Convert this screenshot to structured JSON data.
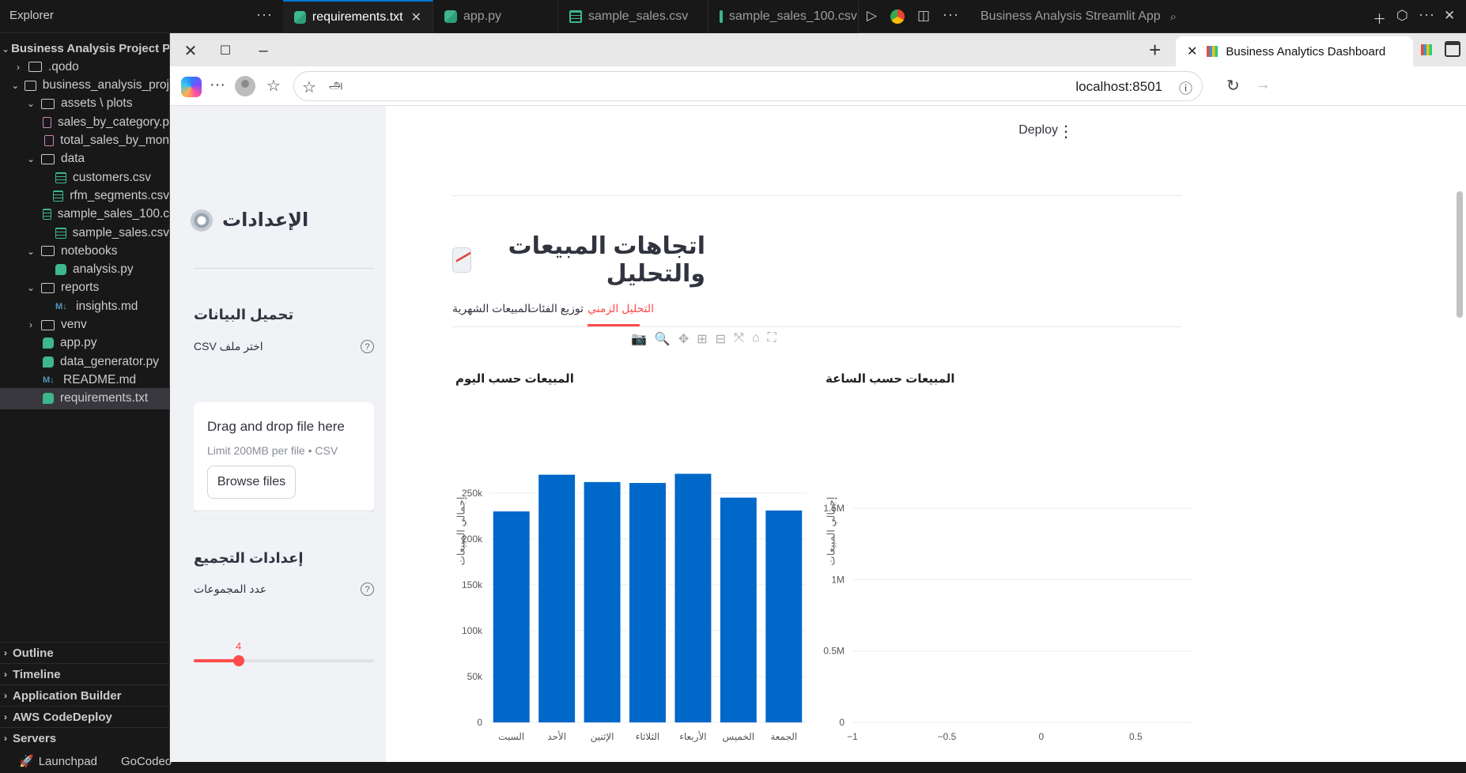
{
  "ide": {
    "explorer_title": "Explorer",
    "tabs": [
      {
        "label": "requirements.txt",
        "icon": "python-file-icon",
        "active": true
      },
      {
        "label": "app.py",
        "icon": "python-file-icon",
        "active": false
      },
      {
        "label": "sample_sales.csv",
        "icon": "csv-file-icon",
        "active": false
      },
      {
        "label": "sample_sales_100.csv",
        "icon": "csv-file-icon",
        "active": false
      }
    ],
    "right_tab_label": "Business Analysis Streamlit App",
    "tree": [
      {
        "label": "Business Analysis Project Pyth",
        "type": "root",
        "indent": 0
      },
      {
        "label": ".qodo",
        "type": "folder",
        "indent": 1,
        "open": false
      },
      {
        "label": "business_analysis_proj",
        "type": "folder",
        "indent": 1,
        "open": true
      },
      {
        "label": "assets \\ plots",
        "type": "folder",
        "indent": 2,
        "open": true
      },
      {
        "label": "sales_by_category.p",
        "type": "image",
        "indent": 3
      },
      {
        "label": "total_sales_by_mon",
        "type": "image",
        "indent": 3
      },
      {
        "label": "data",
        "type": "folder",
        "indent": 2,
        "open": true
      },
      {
        "label": "customers.csv",
        "type": "csv",
        "indent": 3
      },
      {
        "label": "rfm_segments.csv",
        "type": "csv",
        "indent": 3
      },
      {
        "label": "sample_sales_100.c",
        "type": "csv",
        "indent": 3
      },
      {
        "label": "sample_sales.csv",
        "type": "csv",
        "indent": 3
      },
      {
        "label": "notebooks",
        "type": "folder",
        "indent": 2,
        "open": true
      },
      {
        "label": "analysis.py",
        "type": "python",
        "indent": 3
      },
      {
        "label": "reports",
        "type": "folder",
        "indent": 2,
        "open": true
      },
      {
        "label": "insights.md",
        "type": "markdown",
        "indent": 3
      },
      {
        "label": "venv",
        "type": "folder",
        "indent": 2,
        "open": false
      },
      {
        "label": "app.py",
        "type": "python",
        "indent": 2
      },
      {
        "label": "data_generator.py",
        "type": "python",
        "indent": 2
      },
      {
        "label": "README.md",
        "type": "markdown",
        "indent": 2
      },
      {
        "label": "requirements.txt",
        "type": "python",
        "indent": 2,
        "selected": true
      }
    ],
    "panels": [
      "Outline",
      "Timeline",
      "Application Builder",
      "AWS CodeDeploy",
      "Servers"
    ],
    "statusbar": [
      "Launchpad",
      "GoCodeo"
    ]
  },
  "browser": {
    "tab_title": "Business Analytics Dashboard",
    "url": "localhost:8501",
    "read_aloud_glyph": "அ"
  },
  "sidebar": {
    "settings_title": "الإعدادات",
    "upload_header": "تحميل البيانات",
    "file_label": "اختر ملف CSV",
    "dropzone_title": "Drag and drop file here",
    "dropzone_limit": "Limit 200MB per file • CSV",
    "browse_label": "Browse files",
    "clustering_header": "إعدادات التجميع",
    "clusters_label": "عدد المجموعات",
    "slider": {
      "value": 4,
      "min": 2,
      "max": 10
    }
  },
  "main": {
    "deploy_label": "Deploy",
    "section_title": "اتجاهات المبيعات والتحليل",
    "tabs": [
      {
        "label": "المبيعات الشهرية",
        "active": false
      },
      {
        "label": "توزيع الفئات",
        "active": false
      },
      {
        "label": "التحليل الزمني",
        "active": true
      }
    ]
  },
  "chart_data": [
    {
      "type": "bar",
      "title": "المبيعات حسب اليوم",
      "ylabel": "إجمالي المبيعات",
      "xlabel": "",
      "categories": [
        "السبت",
        "الأحد",
        "الإثنين",
        "الثلاثاء",
        "الأربعاء",
        "الخميس",
        "الجمعة"
      ],
      "values": [
        230000,
        270000,
        262000,
        261000,
        271000,
        245000,
        231000
      ],
      "ylim": [
        0,
        280000
      ],
      "yticks": [
        0,
        50000,
        100000,
        150000,
        200000,
        250000
      ],
      "ytick_labels": [
        "0",
        "50k",
        "100k",
        "150k",
        "200k",
        "250k"
      ],
      "color": "#0068c9",
      "grid": true
    },
    {
      "type": "line",
      "title": "المبيعات حسب الساعة",
      "ylabel": "إجمالي المبيعات",
      "xlabel": "",
      "x": [],
      "y": [],
      "xlim": [
        -1,
        0.8
      ],
      "ylim": [
        0,
        1800000
      ],
      "xticks": [
        -1,
        -0.5,
        0,
        0.5
      ],
      "xtick_labels": [
        "−1",
        "−0.5",
        "0",
        "0.5"
      ],
      "yticks": [
        0,
        500000,
        1000000,
        1500000
      ],
      "ytick_labels": [
        "0",
        "0.5M",
        "1M",
        "1.5M"
      ],
      "grid": true
    }
  ]
}
